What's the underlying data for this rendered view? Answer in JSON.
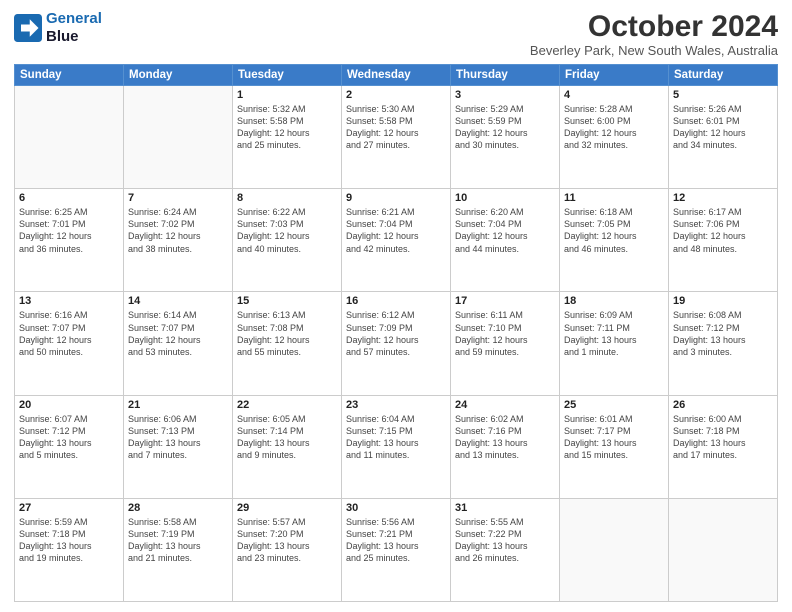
{
  "logo": {
    "line1": "General",
    "line2": "Blue"
  },
  "title": "October 2024",
  "location": "Beverley Park, New South Wales, Australia",
  "weekdays": [
    "Sunday",
    "Monday",
    "Tuesday",
    "Wednesday",
    "Thursday",
    "Friday",
    "Saturday"
  ],
  "weeks": [
    [
      {
        "day": "",
        "info": ""
      },
      {
        "day": "",
        "info": ""
      },
      {
        "day": "1",
        "info": "Sunrise: 5:32 AM\nSunset: 5:58 PM\nDaylight: 12 hours\nand 25 minutes."
      },
      {
        "day": "2",
        "info": "Sunrise: 5:30 AM\nSunset: 5:58 PM\nDaylight: 12 hours\nand 27 minutes."
      },
      {
        "day": "3",
        "info": "Sunrise: 5:29 AM\nSunset: 5:59 PM\nDaylight: 12 hours\nand 30 minutes."
      },
      {
        "day": "4",
        "info": "Sunrise: 5:28 AM\nSunset: 6:00 PM\nDaylight: 12 hours\nand 32 minutes."
      },
      {
        "day": "5",
        "info": "Sunrise: 5:26 AM\nSunset: 6:01 PM\nDaylight: 12 hours\nand 34 minutes."
      }
    ],
    [
      {
        "day": "6",
        "info": "Sunrise: 6:25 AM\nSunset: 7:01 PM\nDaylight: 12 hours\nand 36 minutes."
      },
      {
        "day": "7",
        "info": "Sunrise: 6:24 AM\nSunset: 7:02 PM\nDaylight: 12 hours\nand 38 minutes."
      },
      {
        "day": "8",
        "info": "Sunrise: 6:22 AM\nSunset: 7:03 PM\nDaylight: 12 hours\nand 40 minutes."
      },
      {
        "day": "9",
        "info": "Sunrise: 6:21 AM\nSunset: 7:04 PM\nDaylight: 12 hours\nand 42 minutes."
      },
      {
        "day": "10",
        "info": "Sunrise: 6:20 AM\nSunset: 7:04 PM\nDaylight: 12 hours\nand 44 minutes."
      },
      {
        "day": "11",
        "info": "Sunrise: 6:18 AM\nSunset: 7:05 PM\nDaylight: 12 hours\nand 46 minutes."
      },
      {
        "day": "12",
        "info": "Sunrise: 6:17 AM\nSunset: 7:06 PM\nDaylight: 12 hours\nand 48 minutes."
      }
    ],
    [
      {
        "day": "13",
        "info": "Sunrise: 6:16 AM\nSunset: 7:07 PM\nDaylight: 12 hours\nand 50 minutes."
      },
      {
        "day": "14",
        "info": "Sunrise: 6:14 AM\nSunset: 7:07 PM\nDaylight: 12 hours\nand 53 minutes."
      },
      {
        "day": "15",
        "info": "Sunrise: 6:13 AM\nSunset: 7:08 PM\nDaylight: 12 hours\nand 55 minutes."
      },
      {
        "day": "16",
        "info": "Sunrise: 6:12 AM\nSunset: 7:09 PM\nDaylight: 12 hours\nand 57 minutes."
      },
      {
        "day": "17",
        "info": "Sunrise: 6:11 AM\nSunset: 7:10 PM\nDaylight: 12 hours\nand 59 minutes."
      },
      {
        "day": "18",
        "info": "Sunrise: 6:09 AM\nSunset: 7:11 PM\nDaylight: 13 hours\nand 1 minute."
      },
      {
        "day": "19",
        "info": "Sunrise: 6:08 AM\nSunset: 7:12 PM\nDaylight: 13 hours\nand 3 minutes."
      }
    ],
    [
      {
        "day": "20",
        "info": "Sunrise: 6:07 AM\nSunset: 7:12 PM\nDaylight: 13 hours\nand 5 minutes."
      },
      {
        "day": "21",
        "info": "Sunrise: 6:06 AM\nSunset: 7:13 PM\nDaylight: 13 hours\nand 7 minutes."
      },
      {
        "day": "22",
        "info": "Sunrise: 6:05 AM\nSunset: 7:14 PM\nDaylight: 13 hours\nand 9 minutes."
      },
      {
        "day": "23",
        "info": "Sunrise: 6:04 AM\nSunset: 7:15 PM\nDaylight: 13 hours\nand 11 minutes."
      },
      {
        "day": "24",
        "info": "Sunrise: 6:02 AM\nSunset: 7:16 PM\nDaylight: 13 hours\nand 13 minutes."
      },
      {
        "day": "25",
        "info": "Sunrise: 6:01 AM\nSunset: 7:17 PM\nDaylight: 13 hours\nand 15 minutes."
      },
      {
        "day": "26",
        "info": "Sunrise: 6:00 AM\nSunset: 7:18 PM\nDaylight: 13 hours\nand 17 minutes."
      }
    ],
    [
      {
        "day": "27",
        "info": "Sunrise: 5:59 AM\nSunset: 7:18 PM\nDaylight: 13 hours\nand 19 minutes."
      },
      {
        "day": "28",
        "info": "Sunrise: 5:58 AM\nSunset: 7:19 PM\nDaylight: 13 hours\nand 21 minutes."
      },
      {
        "day": "29",
        "info": "Sunrise: 5:57 AM\nSunset: 7:20 PM\nDaylight: 13 hours\nand 23 minutes."
      },
      {
        "day": "30",
        "info": "Sunrise: 5:56 AM\nSunset: 7:21 PM\nDaylight: 13 hours\nand 25 minutes."
      },
      {
        "day": "31",
        "info": "Sunrise: 5:55 AM\nSunset: 7:22 PM\nDaylight: 13 hours\nand 26 minutes."
      },
      {
        "day": "",
        "info": ""
      },
      {
        "day": "",
        "info": ""
      }
    ]
  ]
}
